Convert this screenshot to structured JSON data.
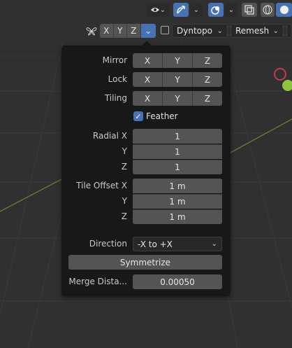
{
  "header": {
    "x_label": "X",
    "y_label": "Y",
    "z_label": "Z",
    "dyntopo_label": "Dyntopo",
    "remesh_label": "Remesh"
  },
  "popover": {
    "mirror": {
      "label": "Mirror",
      "x": "X",
      "y": "Y",
      "z": "Z"
    },
    "lock": {
      "label": "Lock",
      "x": "X",
      "y": "Y",
      "z": "Z"
    },
    "tiling": {
      "label": "Tiling",
      "x": "X",
      "y": "Y",
      "z": "Z"
    },
    "feather": {
      "label": "Feather",
      "checked": true
    },
    "radial": {
      "label_x": "Radial X",
      "label_y": "Y",
      "label_z": "Z",
      "value_x": "1",
      "value_y": "1",
      "value_z": "1"
    },
    "tile_offset": {
      "label_x": "Tile Offset X",
      "label_y": "Y",
      "label_z": "Z",
      "value_x": "1 m",
      "value_y": "1 m",
      "value_z": "1 m"
    },
    "direction": {
      "label": "Direction",
      "value": "-X to +X"
    },
    "symmetrize_label": "Symmetrize",
    "merge_distance": {
      "label": "Merge Dista...",
      "value": "0.00050"
    }
  },
  "colors": {
    "accent": "#4772b3",
    "button": "#545454",
    "panel": "#181818",
    "viewport": "#303030"
  }
}
